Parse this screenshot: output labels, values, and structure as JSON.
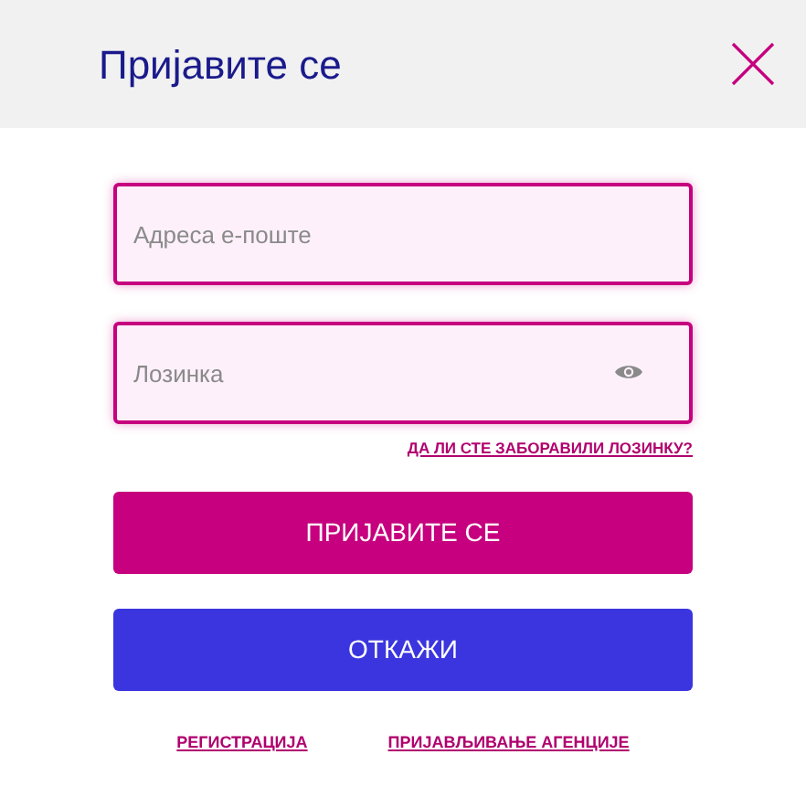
{
  "header": {
    "title": "Пријавите се"
  },
  "fields": [
    {
      "kind": "text",
      "placeholder": "Адреса е-поште"
    },
    {
      "kind": "password",
      "placeholder": "Лозинка"
    }
  ],
  "forgot_link": "ДА ЛИ СТЕ ЗАБОРАВИЛИ ЛОЗИНКУ?",
  "buttons": [
    {
      "kind": "primary",
      "label": "ПРИЈАВИТЕ СЕ"
    },
    {
      "kind": "secondary",
      "label": "ОТКАЖИ"
    }
  ],
  "footer_links": [
    "РЕГИСТРАЦИЈА",
    "ПРИЈАВЉИВАЊЕ АГЕНЦИЈЕ"
  ]
}
